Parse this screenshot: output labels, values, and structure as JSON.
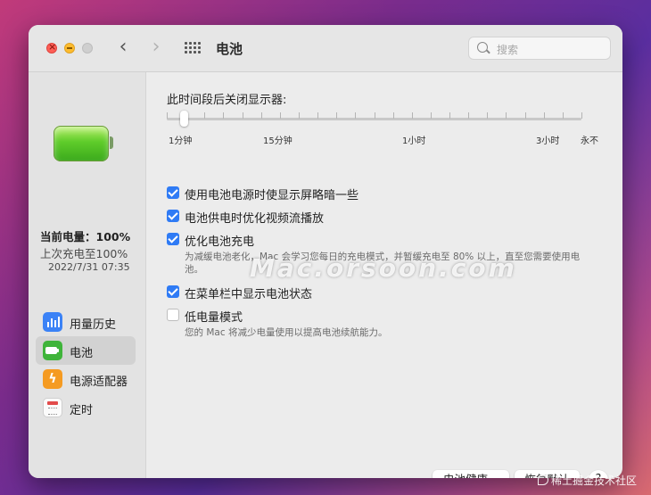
{
  "window": {
    "title": "电池",
    "search_placeholder": "搜索"
  },
  "sidebar": {
    "charge_current": "当前电量：100%",
    "last_charged": "上次充电至100%",
    "last_charged_time": "2022/7/31 07:35",
    "items": [
      {
        "label": "用量历史",
        "icon": "bar-chart-icon",
        "selected": false
      },
      {
        "label": "电池",
        "icon": "battery-icon",
        "selected": true
      },
      {
        "label": "电源适配器",
        "icon": "lightning-icon",
        "selected": false
      },
      {
        "label": "定时",
        "icon": "calendar-icon",
        "selected": false
      }
    ]
  },
  "display_off": {
    "label": "此时间段后关闭显示器:",
    "value_fraction": 0.04,
    "ticks": [
      "1分钟",
      "15分钟",
      "1小时",
      "3小时",
      "永不"
    ]
  },
  "options": [
    {
      "label": "使用电池电源时使显示屏略暗一些",
      "checked": true
    },
    {
      "label": "电池供电时优化视频流播放",
      "checked": true
    },
    {
      "label": "优化电池充电",
      "checked": true,
      "description": "为减缓电池老化，Mac 会学习您每日的充电模式，并暂缓充电至 80% 以上，直至您需要使用电池。"
    },
    {
      "label": "在菜单栏中显示电池状态",
      "checked": true
    },
    {
      "label": "低电量模式",
      "checked": false,
      "description": "您的 Mac 将减少电量使用以提高电池续航能力。"
    }
  ],
  "buttons": {
    "battery_health": "电池健康...",
    "restore_defaults": "恢复默认",
    "help": "?"
  },
  "overlays": {
    "watermark": "Mac.orsoon.com",
    "credit": "稀土掘金技术社区"
  },
  "colors": {
    "accent": "#2f7bf5",
    "battery_green": "#5fcc2a",
    "close": "#fe5f57",
    "minimize": "#febc2e"
  }
}
